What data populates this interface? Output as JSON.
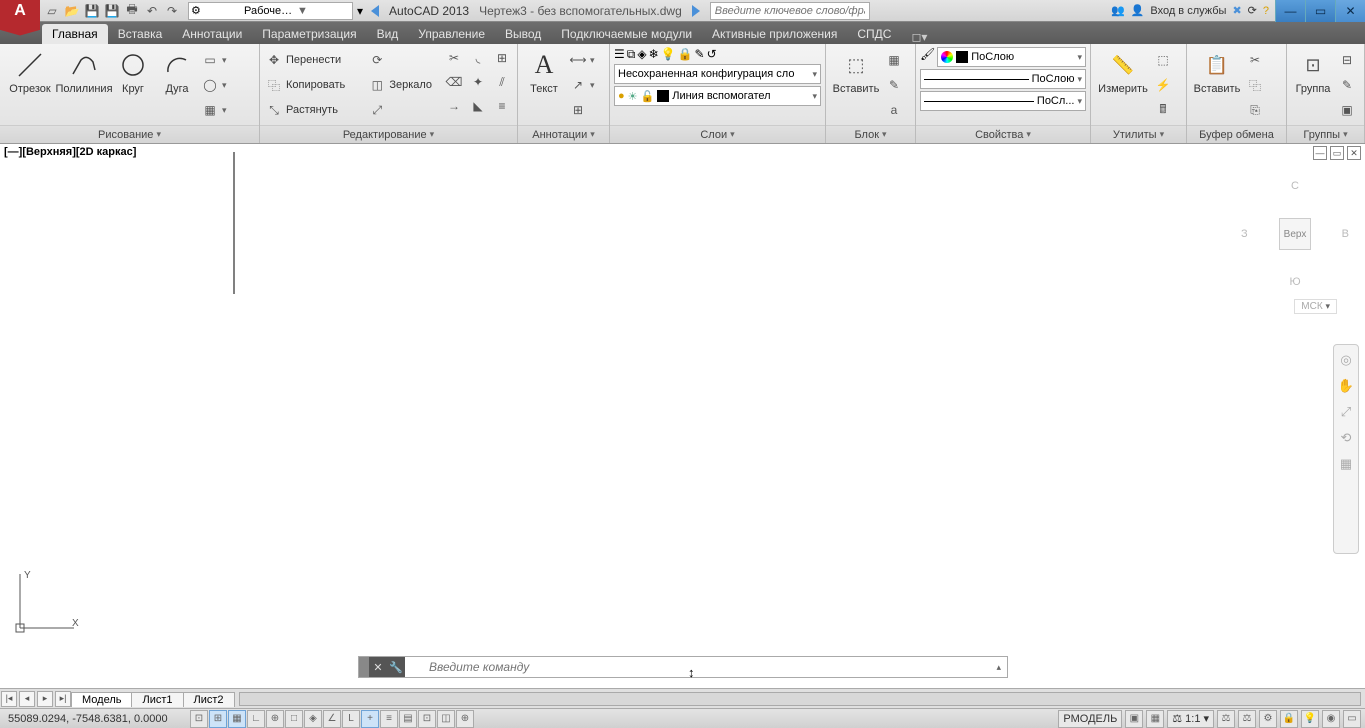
{
  "titlebar": {
    "workspace": "Рабочее пространство...",
    "app_name": "AutoCAD 2013",
    "doc_name": "Чертеж3 - без вспомогательных.dwg",
    "search_placeholder": "Введите ключевое слово/фразу",
    "login": "Вход в службы",
    "win": {
      "min": "—",
      "max": "▭",
      "close": "✕"
    }
  },
  "ribbon_tabs": [
    "Главная",
    "Вставка",
    "Аннотации",
    "Параметризация",
    "Вид",
    "Управление",
    "Вывод",
    "Подключаемые модули",
    "Активные приложения",
    "СПДС"
  ],
  "ribbon": {
    "draw": {
      "title": "Рисование",
      "line": "Отрезок",
      "polyline": "Полилиния",
      "circle": "Круг",
      "arc": "Дуга"
    },
    "modify": {
      "title": "Редактирование",
      "move": "Перенести",
      "copy": "Копировать",
      "stretch": "Растянуть",
      "rotate": "⟳",
      "mirror": "Зеркало",
      "scale": "⤢"
    },
    "annotation": {
      "title": "Аннотации",
      "text": "Текст"
    },
    "layers": {
      "title": "Слои",
      "unsaved": "Несохраненная конфигурация сло",
      "current": "Линия вспомогател"
    },
    "block": {
      "title": "Блок",
      "insert": "Вставить"
    },
    "properties": {
      "title": "Свойства",
      "bylayer": "ПоСлою",
      "lw": "ПоСлою",
      "lt": "ПоСл..."
    },
    "utilities": {
      "title": "Утилиты",
      "measure": "Измерить"
    },
    "clipboard": {
      "title": "Буфер обмена",
      "paste": "Вставить"
    },
    "groups": {
      "title": "Группы",
      "group": "Группа"
    }
  },
  "viewport": {
    "label": "[—][Верхняя][2D каркас]",
    "cube": {
      "top": "Верх",
      "n": "С",
      "s": "Ю",
      "e": "В",
      "w": "З",
      "wcs": "МСК"
    }
  },
  "cmdline": {
    "placeholder": "Введите команду"
  },
  "sheets": {
    "model": "Модель",
    "sheet1": "Лист1",
    "sheet2": "Лист2"
  },
  "status": {
    "coords": "55089.0294, -7548.6381, 0.0000",
    "space": "РМОДЕЛЬ",
    "scale": "1:1"
  }
}
